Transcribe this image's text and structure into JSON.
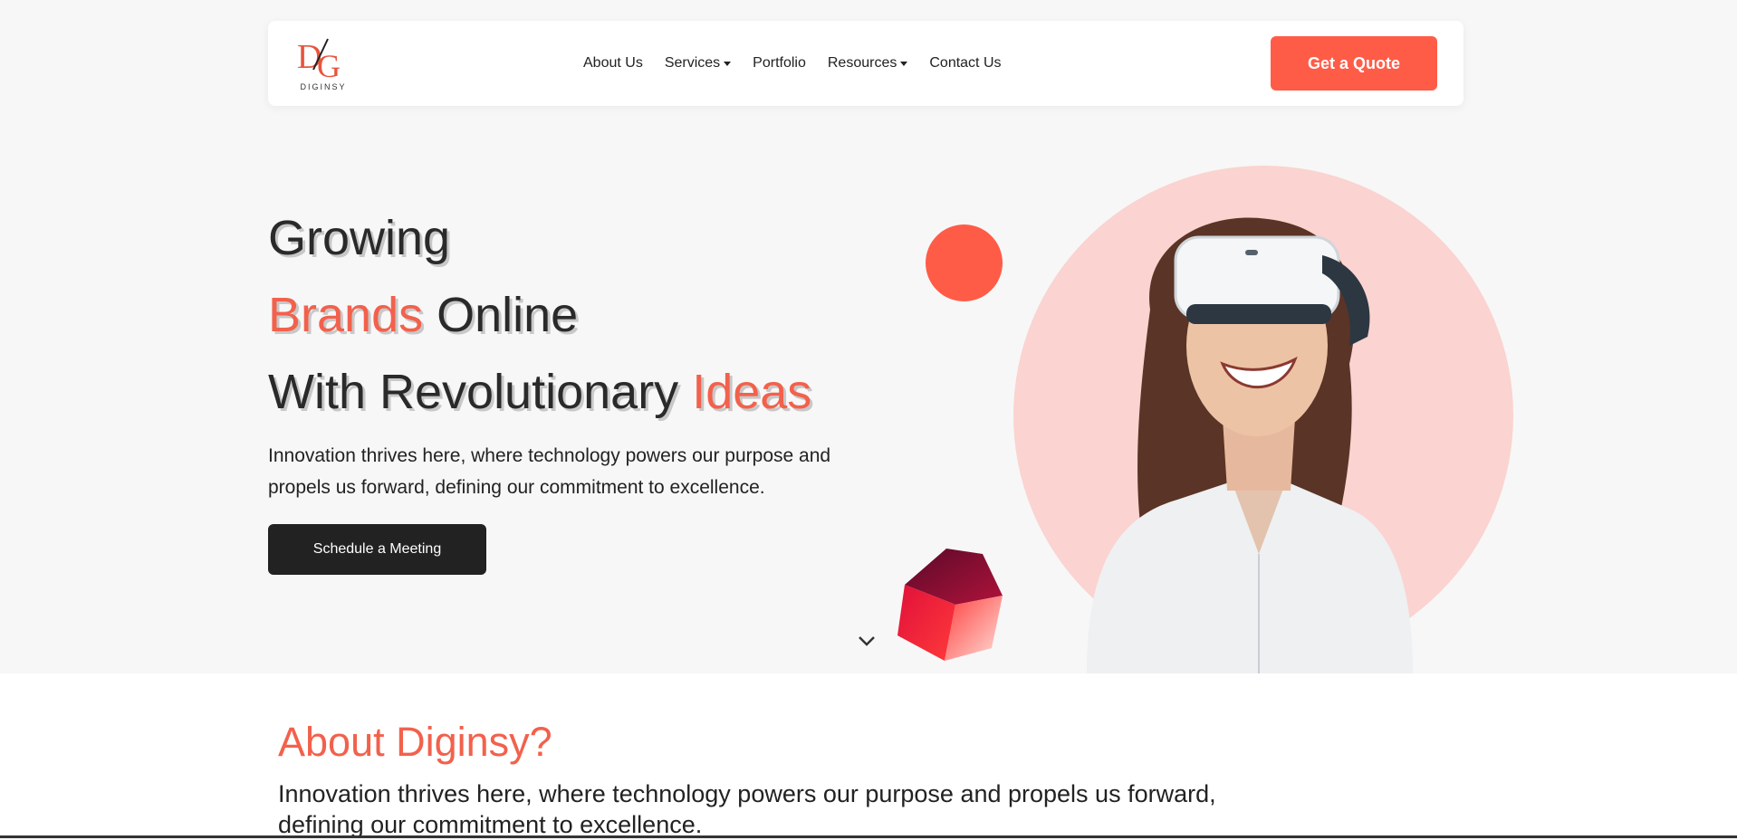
{
  "brand": {
    "logo_letters": "DG",
    "logo_name": "DIGINSY"
  },
  "nav": {
    "items": [
      {
        "label": "About Us",
        "dropdown": false
      },
      {
        "label": "Services",
        "dropdown": true
      },
      {
        "label": "Portfolio",
        "dropdown": false
      },
      {
        "label": "Resources",
        "dropdown": true
      },
      {
        "label": "Contact Us",
        "dropdown": false
      }
    ],
    "cta_label": "Get a Quote"
  },
  "hero": {
    "line1": "Growing",
    "line2_accent": "Brands",
    "line2_rest": " Online",
    "line3_rest": "With Revolutionary ",
    "line3_accent": "Ideas",
    "subtitle": "Innovation thrives here, where technology powers our purpose and propels us forward, defining our commitment to excellence.",
    "button_label": "Schedule a Meeting"
  },
  "about": {
    "title": "About Diginsy?",
    "text": "Innovation thrives here, where technology powers our purpose and propels us forward, defining our commitment to excellence."
  },
  "icons": {
    "scroll": "chevron-down-icon",
    "hero_image": "woman-vr-headset-illustration",
    "decor_shape": "red-cube-icon"
  },
  "colors": {
    "accent": "#ff5c48",
    "accent_text": "#f2614c",
    "dark": "#222222",
    "pink_circle": "#fbd3d0",
    "background": "#f7f7f7"
  }
}
